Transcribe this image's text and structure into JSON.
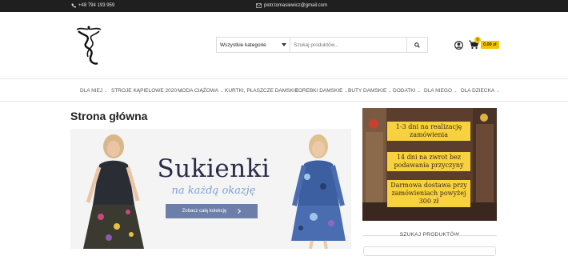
{
  "topbar": {
    "phone": "+48 794 193 959",
    "email": "piotr.tomasiewicz@gmail.com"
  },
  "search": {
    "category": "Wszystkie kategorie",
    "placeholder": "Szukaj produktów..."
  },
  "cart": {
    "count": "0",
    "total": "0,00 zł"
  },
  "nav": {
    "items": [
      {
        "label": "DLA NIEJ",
        "dropdown": true
      },
      {
        "label": "STROJE KĄPIELOWE 2020",
        "dropdown": true
      },
      {
        "label": "MODA CIĄŻOWA",
        "dropdown": true
      },
      {
        "label": "KURTKI, PŁASZCZE DAMSKIE",
        "dropdown": false
      },
      {
        "label": "TOREBKI DAMSKIE",
        "dropdown": true
      },
      {
        "label": "BUTY DAMSKIE",
        "dropdown": true
      },
      {
        "label": "DODATKI",
        "dropdown": true
      },
      {
        "label": "DLA NIEGO",
        "dropdown": true
      },
      {
        "label": "DLA DZIECKA",
        "dropdown": true
      }
    ]
  },
  "page": {
    "title": "Strona główna"
  },
  "banner": {
    "heading": "Sukienki",
    "subheading": "na każdą okazję",
    "button": "Zobacz całą kolekcję",
    "button_icon": "chevron-right-icon"
  },
  "promo": {
    "lines": [
      "1-3 dni na realizację zamówienia",
      "14 dni na zwrot bez podawania przyczyny",
      "Darmowa dostawa przy zamówieniach powyżej 300 zł"
    ]
  },
  "sidebar": {
    "search_title": "SZUKAJ PRODUKTÓW"
  },
  "colors": {
    "accent": "#f5c400",
    "topbar": "#1f1f1f",
    "banner_button": "#6d7fa8"
  }
}
